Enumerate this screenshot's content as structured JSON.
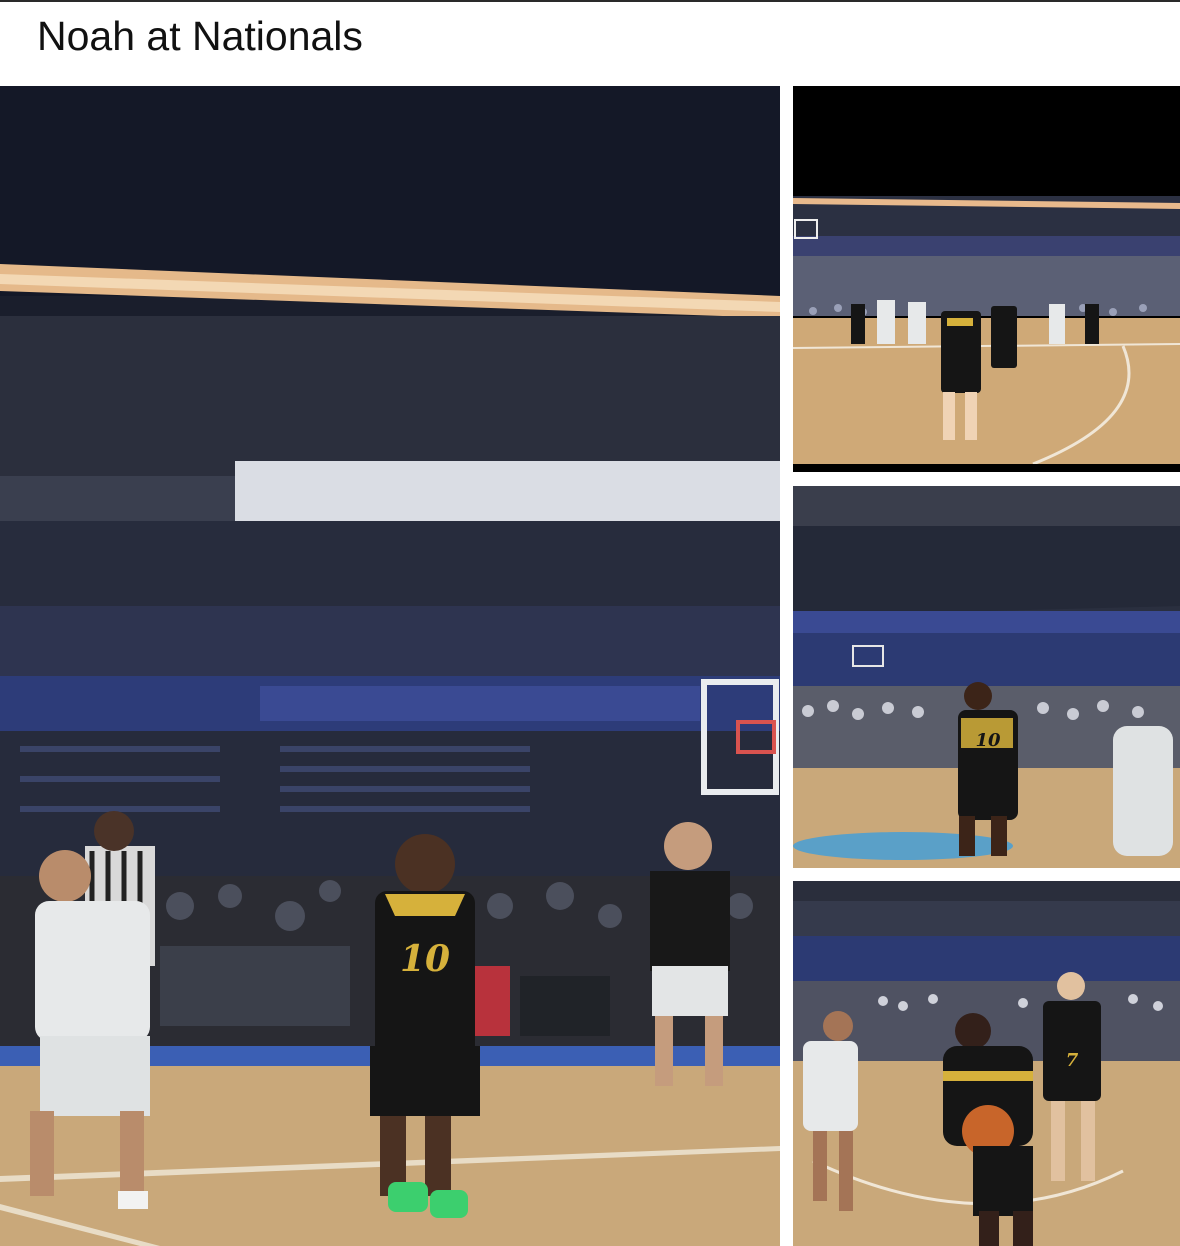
{
  "post": {
    "caption": "Noah at Nationals"
  },
  "photos": [
    {
      "subject": "basketball-game-main"
    },
    {
      "subject": "basketball-game-court-wide"
    },
    {
      "subject": "basketball-player-10"
    },
    {
      "subject": "basketball-player-dribbling"
    }
  ],
  "colors": {
    "court": "#c9a87a",
    "arena_dark": "#1c2133",
    "jersey_black": "#151515",
    "jersey_gold": "#d6b13b",
    "jersey_white": "#e7e9ea",
    "seat_blue": "#2d3c79"
  }
}
